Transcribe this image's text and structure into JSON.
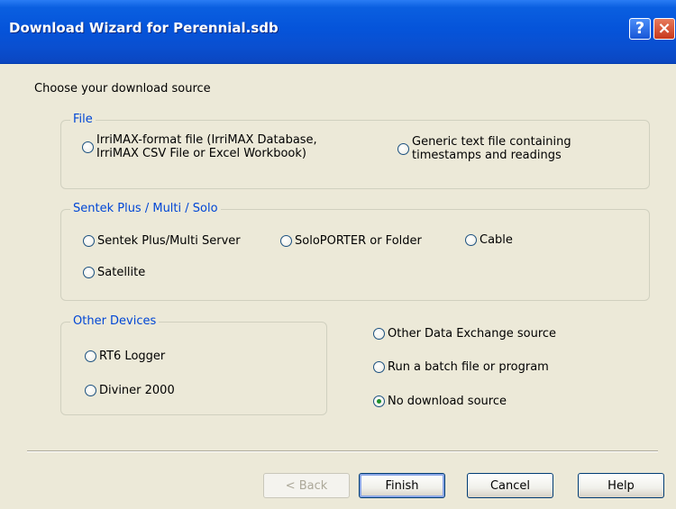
{
  "window": {
    "title": "Download Wizard for Perennial.sdb",
    "help_glyph": "?",
    "close_glyph": "×"
  },
  "prompt": "Choose your download source",
  "groups": {
    "file": {
      "legend": "File",
      "options": [
        {
          "line1": "IrriMAX-format file (IrriMAX Database,",
          "line2": "IrriMAX CSV File or Excel Workbook)",
          "selected": false
        },
        {
          "line1": "Generic text file containing",
          "line2": "timestamps and readings",
          "selected": false
        }
      ]
    },
    "sentek": {
      "legend": "Sentek Plus / Multi / Solo",
      "options": [
        {
          "label": "Sentek Plus/Multi Server",
          "selected": false
        },
        {
          "label": "SoloPORTER or Folder",
          "selected": false
        },
        {
          "label": "Cable",
          "selected": false
        },
        {
          "label": "Satellite",
          "selected": false
        }
      ]
    },
    "other_devices": {
      "legend": "Other Devices",
      "options": [
        {
          "label": "RT6 Logger",
          "selected": false
        },
        {
          "label": "Diviner 2000",
          "selected": false
        }
      ]
    },
    "misc": {
      "options": [
        {
          "label": "Other Data Exchange source",
          "selected": false
        },
        {
          "label": "Run a batch file or program",
          "selected": false
        },
        {
          "label": "No download source",
          "selected": true
        }
      ]
    }
  },
  "buttons": {
    "back": "< Back",
    "finish": "Finish",
    "cancel": "Cancel",
    "help": "Help"
  },
  "colors": {
    "titlebar": "#0554da",
    "legend": "#0046d5",
    "dialog_bg": "#ece9d8",
    "radio_dot": "#1d8f2a"
  }
}
